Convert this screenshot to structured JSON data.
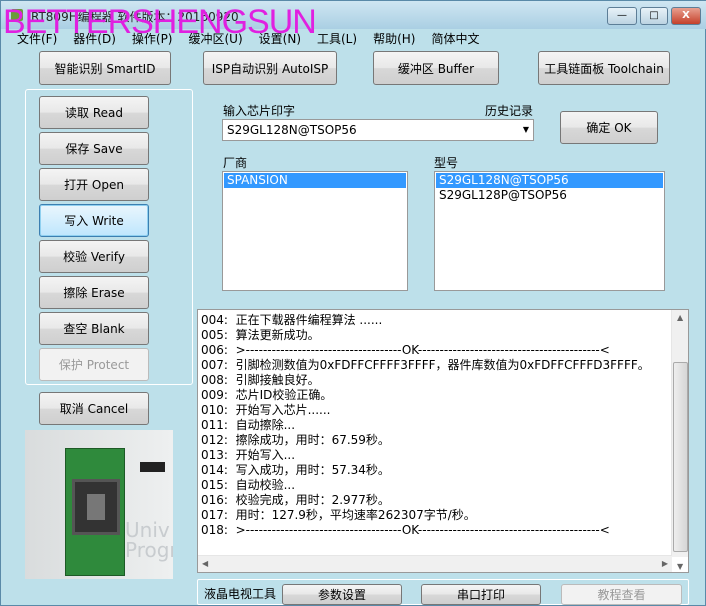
{
  "window": {
    "title": "RT809H编程器  软件版本：20160920",
    "watermark": "BETTERSHENGSUN",
    "minimize": "—",
    "maximize": "□",
    "close": "X"
  },
  "menu": [
    "文件(F)",
    "器件(D)",
    "操作(P)",
    "缓冲区(U)",
    "设置(N)",
    "工具(L)",
    "帮助(H)",
    "简体中文"
  ],
  "toolbar": {
    "smartid": "智能识别 SmartID",
    "autoisp": "ISP自动识别 AutoISP",
    "buffer": "缓冲区 Buffer",
    "toolchain": "工具链面板 Toolchain"
  },
  "actions": {
    "read": "读取 Read",
    "save": "保存 Save",
    "open": "打开 Open",
    "write": "写入 Write",
    "verify": "校验 Verify",
    "erase": "擦除 Erase",
    "blank": "查空 Blank",
    "protect": "保护 Protect",
    "cancel": "取消 Cancel"
  },
  "chip": {
    "input_label": "输入芯片印字",
    "history_label": "历史记录",
    "input_value": "S29GL128N@TSOP56",
    "ok": "确定 OK"
  },
  "vendor": {
    "label": "厂商",
    "items": [
      "SPANSION"
    ]
  },
  "model": {
    "label": "型号",
    "items": [
      "S29GL128N@TSOP56",
      "S29GL128P@TSOP56"
    ]
  },
  "log": [
    "004:  正在下载器件编程算法 ......",
    "005:  算法更新成功。",
    "006:  >------------------------------------OK------------------------------------------<",
    "007:  引脚检测数值为0xFDFFCFFFF3FFFF，器件库数值为0xFDFFCFFFD3FFFF。",
    "008:  引脚接触良好。",
    "009:  芯片ID校验正确。",
    "010:  开始写入芯片......",
    "011:  自动擦除...",
    "012:  擦除成功，用时：67.59秒。",
    "013:  开始写入...",
    "014:  写入成功，用时：57.34秒。",
    "015:  自动校验...",
    "016:  校验完成，用时：2.977秒。",
    "017:  用时：127.9秒，平均速率262307字节/秒。",
    "018:  >------------------------------------OK------------------------------------------<"
  ],
  "bottom": {
    "label": "液晶电视工具",
    "params": "参数设置",
    "serial": "串口打印",
    "tutorial": "教程查看"
  }
}
